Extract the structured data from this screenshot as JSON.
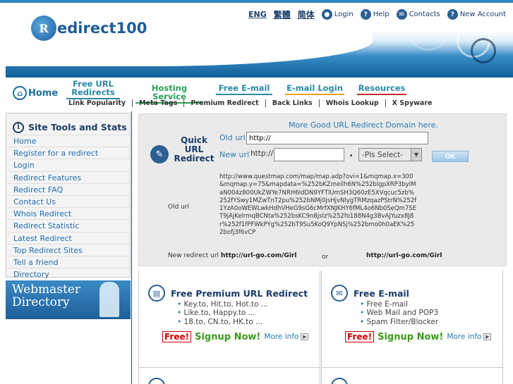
{
  "header": {
    "logo_mark": "R",
    "logo_text": "edirect100",
    "lang_links": [
      "ENG",
      "繁體",
      "简体"
    ],
    "top_links": [
      {
        "icon": "user-icon",
        "glyph": "●",
        "label": "Login"
      },
      {
        "icon": "help-icon",
        "glyph": "?",
        "label": "Help"
      },
      {
        "icon": "contacts-icon",
        "glyph": "✉",
        "label": "Contacts"
      },
      {
        "icon": "new-account-icon",
        "glyph": "?",
        "label": "New Account"
      }
    ]
  },
  "nav": {
    "home_label": "Home",
    "tabs": [
      {
        "label": "Free URL Redirects",
        "color": "#2a8aa8"
      },
      {
        "label": "Hosting Service",
        "color": "#2ba05a"
      },
      {
        "label": "Free E-mail",
        "color": "#2a8aa8"
      },
      {
        "label": "E-mail Login",
        "color": "#e6a020"
      },
      {
        "label": "Resources",
        "color": "#c03030"
      }
    ],
    "subnav": [
      "Link Popularity",
      "Meta Tags",
      "Premium Redirect",
      "Back Links",
      "Whois Lookup",
      "X Spyware"
    ]
  },
  "sidebar": {
    "title": "Site Tools and Stats",
    "items": [
      "Home",
      "Register for a redirect",
      "Login",
      "Redirect Features",
      "Redirect FAQ",
      "Contact Us",
      "Whois Redirect",
      "Redirect Statistic",
      "Latest Redirect",
      "Top Redirect Sites",
      "Tell a friend",
      "Directory"
    ],
    "banner_line1": "Webmaster",
    "banner_line2": "Directory"
  },
  "redirect": {
    "more_link": "More Good URL Redirect Domain here.",
    "title_l1": "Quick",
    "title_l2": "URL",
    "title_l3": "Redirect",
    "old_url_label": "Old url",
    "old_url_value": "http://",
    "new_url_label": "New url",
    "new_url_prefix": "http://",
    "new_url_value": "",
    "dot": ".",
    "select_value": "-Pls Select-",
    "ok_label": "OK",
    "sample_old_url": "http://www.questmap.com/map/map.adp?ovi=1&mqmap.x=300&mqmap.y=75&mapdata=%252bKZmeilh6N%252blgpXRP3byIMaN004z800UkZWYe7NRH6IdDN9YFTlUmSH3Q60zE5XVqcuc5zb%252fYSwy1MZwTnT2pu%252bNMj0jsHjvNlygTRMzqazPStrN%252f1YzA0oWEWLwkHdhVHeG9sG6cMrfXNJKHY6fML4o6Nb0SeQm7SET9jAjKelrmqBCNta%252bsKC9n8jslz%252fo188N4g3BvAJYuzx8J8r%252f1fPFWkPYg%252bT9Su5KoQ9YpNSj%252bmo0h0aEK%252bofj3f6vCP",
    "old_url_caption": "Old url",
    "new_url_caption": "New redirect url",
    "new_url_example1": "http://url-go.com/Girl",
    "or_label": "or",
    "new_url_example2": "http://url-go.com/Girl"
  },
  "box_premium": {
    "title": "Free Premium URL Redirect",
    "bullets": [
      "Key.to, Hit.to, Hot.to ...",
      "Like.to, Happy.to ...",
      "18.to, CN.to, HK.to ..."
    ],
    "free_label": "Free!",
    "signup_label": "Signup Now!",
    "more_label": "More info"
  },
  "box_email": {
    "title": "Free E-mail",
    "bullets": [
      "Free E-mail",
      "Web Mail and POP3",
      "Spam Filter/Blocker"
    ],
    "free_label": "Free!",
    "signup_label": "Signup Now!",
    "more_label": "More info"
  }
}
